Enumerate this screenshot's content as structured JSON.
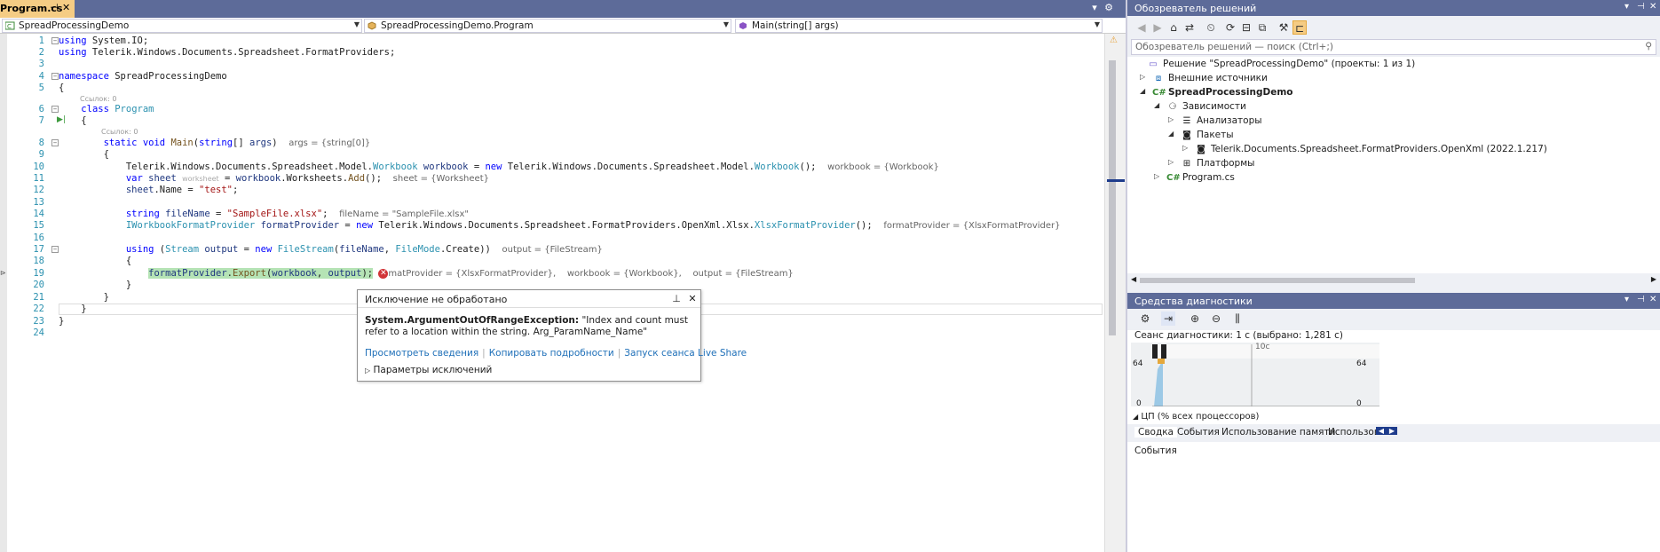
{
  "editor": {
    "tab": {
      "title": "Program.cs",
      "pin": "⊣",
      "close": "✕"
    },
    "tabstrip_buttons": [
      "▾",
      "⚙"
    ],
    "nav": {
      "project": "SpreadProcessingDemo",
      "type": "SpreadProcessingDemo.Program",
      "member": "Main(string[] args)"
    },
    "codelens": [
      "Ссылок: 0",
      "Ссылок: 0"
    ],
    "line_numbers": [
      "1",
      "2",
      "3",
      "4",
      "5",
      "6",
      "7",
      "8",
      "9",
      "10",
      "11",
      "12",
      "13",
      "14",
      "15",
      "16",
      "17",
      "18",
      "19",
      "20",
      "21",
      "22",
      "23",
      "24"
    ],
    "hints": {
      "args": "args = {string[0]}",
      "workbook": "workbook = {Workbook}",
      "sheet_inline": "worksheet",
      "sheet": "sheet = {Worksheet}",
      "fileName": "fileName = \"SampleFile.xlsx\"",
      "formatProvider": "formatProvider = {XlsxFormatProvider}",
      "output": "output = {FileStream}",
      "line19_a": "matProvider = {XlsxFormatProvider},",
      "line19_b": "workbook = {Workbook},",
      "line19_c": "output = {FileStream}"
    }
  },
  "exception_popup": {
    "title": "Исключение не обработано",
    "exception_type": "System.ArgumentOutOfRangeException:",
    "message": "\"Index and count must refer to a location within the string. Arg_ParamName_Name\"",
    "links": [
      "Просмотреть сведения",
      "Копировать подробности",
      "Запуск сеанса Live Share"
    ],
    "params_label": "Параметры исключений"
  },
  "solution_explorer": {
    "title": "Обозреватель решений",
    "search_placeholder": "Обозреватель решений — поиск (Ctrl+;)",
    "nodes": [
      {
        "label": "Решение \"SpreadProcessingDemo\" (проекты: 1 из 1)",
        "icon": "solution-icon",
        "arrow": ""
      },
      {
        "label": "Внешние источники",
        "icon": "external-sources-icon",
        "arrow": "▷"
      },
      {
        "label": "SpreadProcessingDemo",
        "icon": "project-icon",
        "arrow": "◢"
      },
      {
        "label": "Зависимости",
        "icon": "dependencies-icon",
        "arrow": "◢"
      },
      {
        "label": "Анализаторы",
        "icon": "analyzers-icon",
        "arrow": "▷"
      },
      {
        "label": "Пакеты",
        "icon": "packages-icon",
        "arrow": "◢"
      },
      {
        "label": "Telerik.Documents.Spreadsheet.FormatProviders.OpenXml (2022.1.217)",
        "icon": "package-icon",
        "arrow": "▷"
      },
      {
        "label": "Платформы",
        "icon": "frameworks-icon",
        "arrow": "▷"
      },
      {
        "label": "Program.cs",
        "icon": "csharp-file-icon",
        "arrow": "▷"
      }
    ]
  },
  "diagnostics": {
    "title": "Средства диагностики",
    "session": "Сеанс диагностики: 1 с (выбрано: 1,281 с)",
    "axis_label": "10с",
    "left_max": "64",
    "left_min": "0",
    "right_max": "64",
    "right_min": "0",
    "cpu_label": "ЦП (% всех процессоров)",
    "tabs": [
      "Сводка",
      "События",
      "Использование памяти",
      "Использование ЦП"
    ],
    "events_label": "События"
  },
  "colors": {
    "tab_active": "#f5cc84",
    "tabstrip": "#5d6b99",
    "panel_title": "#5d6b99",
    "error": "#d13438",
    "highlight": "#b5e3b5"
  }
}
